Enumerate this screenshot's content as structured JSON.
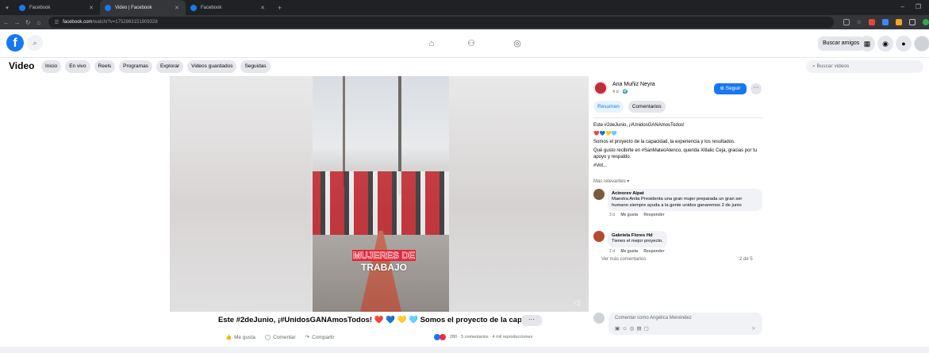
{
  "browser": {
    "tabs": [
      {
        "label": "Facebook",
        "active": false
      },
      {
        "label": "Video | Facebook",
        "active": true
      },
      {
        "label": "Facebook",
        "active": false
      }
    ],
    "url_host": "facebook.com",
    "url_path": "/watch/?v=1752863151909328"
  },
  "fbnav": {
    "find_friends": "Buscar amigos"
  },
  "subnav": {
    "title": "Video",
    "chips": [
      "Inicio",
      "En vivo",
      "Reels",
      "Programas",
      "Explorar",
      "Videos guardados",
      "Seguidas"
    ],
    "search_placeholder": "Buscar videos"
  },
  "video": {
    "overlay_line1": "MUJERES DE",
    "overlay_line2": "TRABAJO",
    "caption": "Este #2deJunio, ¡#UnidosGANAmosTodos! ❤️ 💙 💛 🩵 Somos el proyecto de la cap...",
    "more": "···",
    "actions": {
      "like": "Me gusta",
      "comment": "Comentar",
      "share": "Compartir"
    },
    "stats": "280 · 5 comentarios · 4 mil reproducciones"
  },
  "panel": {
    "author": "Ana Muñiz Neyra",
    "meta": "4 d · 🌍",
    "follow": "Seguir",
    "more": "···",
    "tabs": [
      "Resumen",
      "Comentarios"
    ],
    "desc": [
      "Este #2deJunio, ¡#UnidosGANAmosTodos!",
      "❤️💙💛🩵",
      "Somos el proyecto de la capacidad, la experiencia y los resultados.",
      "Qué gusto recibirte en #SanMateoAtenco, querida Xitlalic Ceja, gracias por tu apoyo y respaldo.",
      "#Vot..."
    ],
    "relevant": "Más relevantes ▾",
    "comments": [
      {
        "name": "Acinorev Aipat",
        "text": "Maestra Anita Presidenta una gran mujer preparada un gran ser humano siempre ayuda a la gente unidos ganaremos 2 de junio",
        "time": "3 d",
        "like": "Me gusta",
        "reply": "Responder"
      },
      {
        "name": "Gabriela Flores Hd",
        "text": "Tienes el mejor proyecto.",
        "time": "2 d",
        "like": "Me gusta",
        "reply": "Responder"
      }
    ],
    "see_more": "Ver más comentarios",
    "count": "2 de 5",
    "composer_placeholder": "Comentar como Angélica Menéndez"
  },
  "colors": {
    "brand": "#1877f2",
    "chip_bg": "#e4e6eb",
    "accent_red": "#e0283a"
  }
}
